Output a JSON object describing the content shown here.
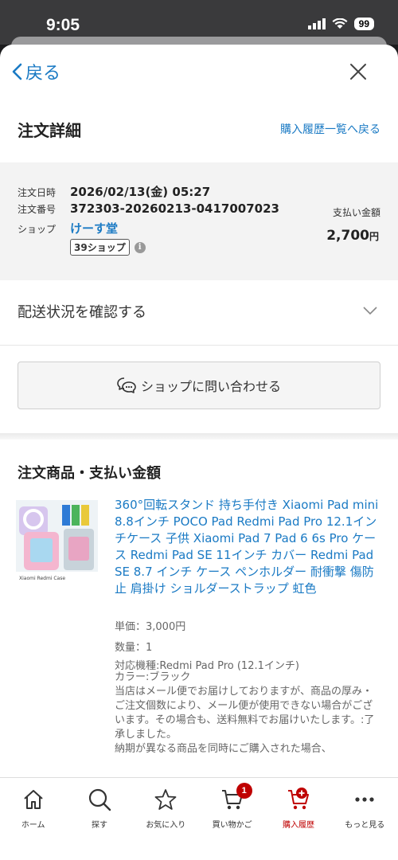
{
  "status": {
    "time": "9:05",
    "battery": "99"
  },
  "nav": {
    "back_label": "戻る"
  },
  "header": {
    "title": "注文詳細",
    "history_link": "購入履歴一覧へ戻る"
  },
  "order": {
    "date_label": "注文日時",
    "date_value": "2026/02/13(金) 05:27",
    "number_label": "注文番号",
    "number_value": "372303-20260213-0417007023",
    "shop_label": "ショップ",
    "shop_name": "けーす堂",
    "shop_badge": "39ショップ",
    "info_icon": "i",
    "pay_label": "支払い金額",
    "pay_amount": "2,700",
    "pay_currency": "円"
  },
  "delivery": {
    "label": "配送状況を確認する"
  },
  "contact": {
    "label": "ショップに問い合わせる"
  },
  "products": {
    "section_title": "注文商品・支払い金額",
    "item": {
      "name": "360°回転スタンド 持ち手付き Xiaomi Pad mini 8.8インチ POCO Pad Redmi Pad Pro 12.1インチケース 子供 Xiaomi Pad 7 Pad 6 6s Pro ケース Redmi Pad SE 11インチ カバー Redmi Pad SE 8.7 インチ ケース ペンホルダー 耐衝撃 傷防止 肩掛け ショルダーストラップ 虹色",
      "unit_price": "単価：3,000円",
      "quantity": "数量：1",
      "model": "対応機種:Redmi Pad Pro (12.1インチ)",
      "color": "カラー:ブラック",
      "description": "当店はメール便でお届けしておりますが、商品の厚み・ご注文個数により、メール便が使用できない場合がございます。その場合も、送料無料でお届けいたします。:了承しました。",
      "description2": "納期が異なる商品を同時にご購入された場合、",
      "thumb_caption": "Xiaomi Redmi Case"
    }
  },
  "tabbar": {
    "items": [
      {
        "label": "ホーム",
        "icon": "home-icon"
      },
      {
        "label": "探す",
        "icon": "search-icon"
      },
      {
        "label": "お気に入り",
        "icon": "star-icon"
      },
      {
        "label": "買い物かご",
        "icon": "cart-icon",
        "badge": "1"
      },
      {
        "label": "購入履歴",
        "icon": "purchase-history-icon",
        "active": true
      },
      {
        "label": "もっと見る",
        "icon": "more-icon"
      }
    ]
  },
  "colors": {
    "accent_link": "#1a7ac4",
    "brand_red": "#bf0000"
  }
}
